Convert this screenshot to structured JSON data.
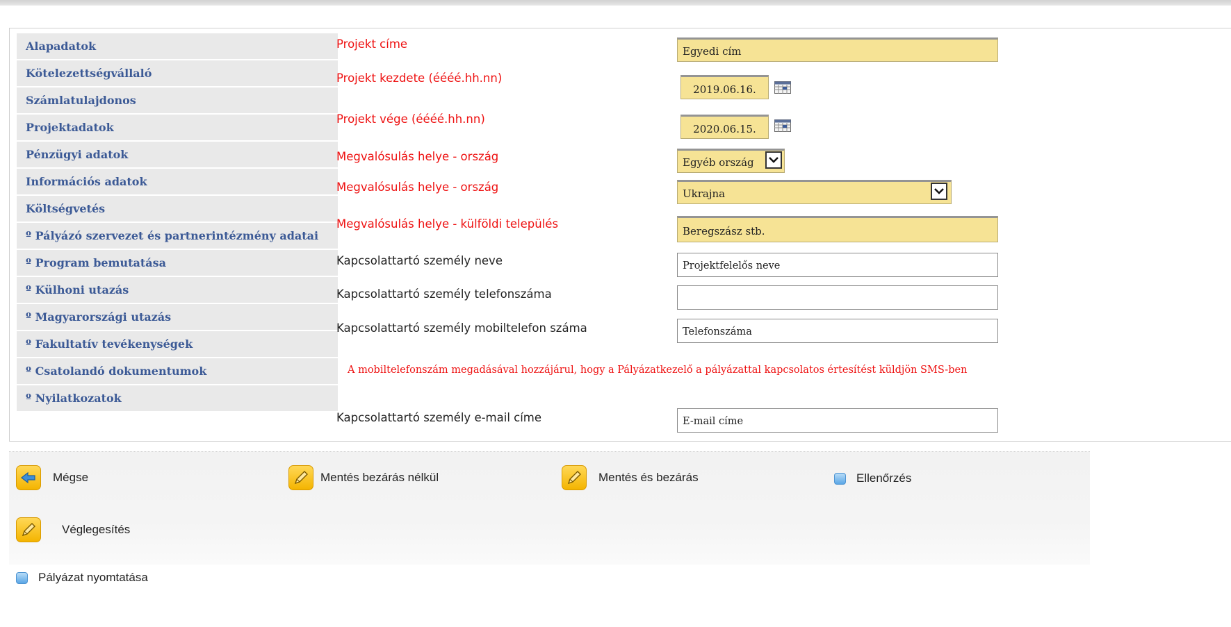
{
  "sidebar": {
    "items": [
      {
        "label": "Alapadatok"
      },
      {
        "label": "Kötelezettségvállaló"
      },
      {
        "label": "Számlatulajdonos"
      },
      {
        "label": "Projektadatok"
      },
      {
        "label": "Pénzügyi adatok"
      },
      {
        "label": "Információs adatok"
      },
      {
        "label": "Költségvetés"
      },
      {
        "label": "º Pályázó szervezet és partnerintézmény adatai"
      },
      {
        "label": "º Program bemutatása"
      },
      {
        "label": "º Külhoni utazás"
      },
      {
        "label": "º Magyarországi utazás"
      },
      {
        "label": "º Fakultatív tevékenységek"
      },
      {
        "label": "º Csatolandó dokumentumok"
      },
      {
        "label": "º Nyilatkozatok"
      }
    ]
  },
  "form": {
    "project_title": {
      "label": "Projekt címe",
      "value": "Egyedi cím"
    },
    "start_date": {
      "label": "Projekt kezdete (éééé.hh.nn)",
      "value": "2019.06.16."
    },
    "end_date": {
      "label": "Projekt vége (éééé.hh.nn)",
      "value": "2020.06.15."
    },
    "country_type": {
      "label": "Megvalósulás helye - ország",
      "value": "Egyéb ország"
    },
    "country": {
      "label": "Megvalósulás helye - ország",
      "value": "Ukrajna"
    },
    "foreign_settlement": {
      "label": "Megvalósulás helye - külföldi település",
      "value": "Beregszász stb."
    },
    "contact_name": {
      "label": "Kapcsolattartó személy neve",
      "value": "Projektfelelős neve"
    },
    "contact_phone": {
      "label": "Kapcsolattartó személy telefonszáma",
      "value": ""
    },
    "contact_mobile": {
      "label": "Kapcsolattartó személy mobiltelefon száma",
      "value": "Telefonszáma"
    },
    "sms_notice": "A mobiltelefonszám megadásával hozzájárul, hogy a Pályázatkezelő a pályázattal kapcsolatos értesítést küldjön SMS-ben",
    "contact_email": {
      "label": "Kapcsolattartó személy e-mail címe",
      "value": "E-mail címe"
    }
  },
  "actions": {
    "cancel": "Mégse",
    "save_no_close": "Mentés bezárás nélkül",
    "save_close": "Mentés és bezárás",
    "check": "Ellenőrzés",
    "finalize": "Véglegesítés",
    "print": "Pályázat nyomtatása"
  },
  "colors": {
    "required_label": "#ee1111",
    "sidebar_text": "#3c5a96",
    "required_input_bg": "#f6e395",
    "action_icon": "#f4b400"
  },
  "icons": {
    "calendar": "calendar-icon",
    "dropdown": "chevron-down-icon",
    "cancel": "back-arrow-icon",
    "edit": "pencil-icon",
    "check": "square-icon"
  }
}
